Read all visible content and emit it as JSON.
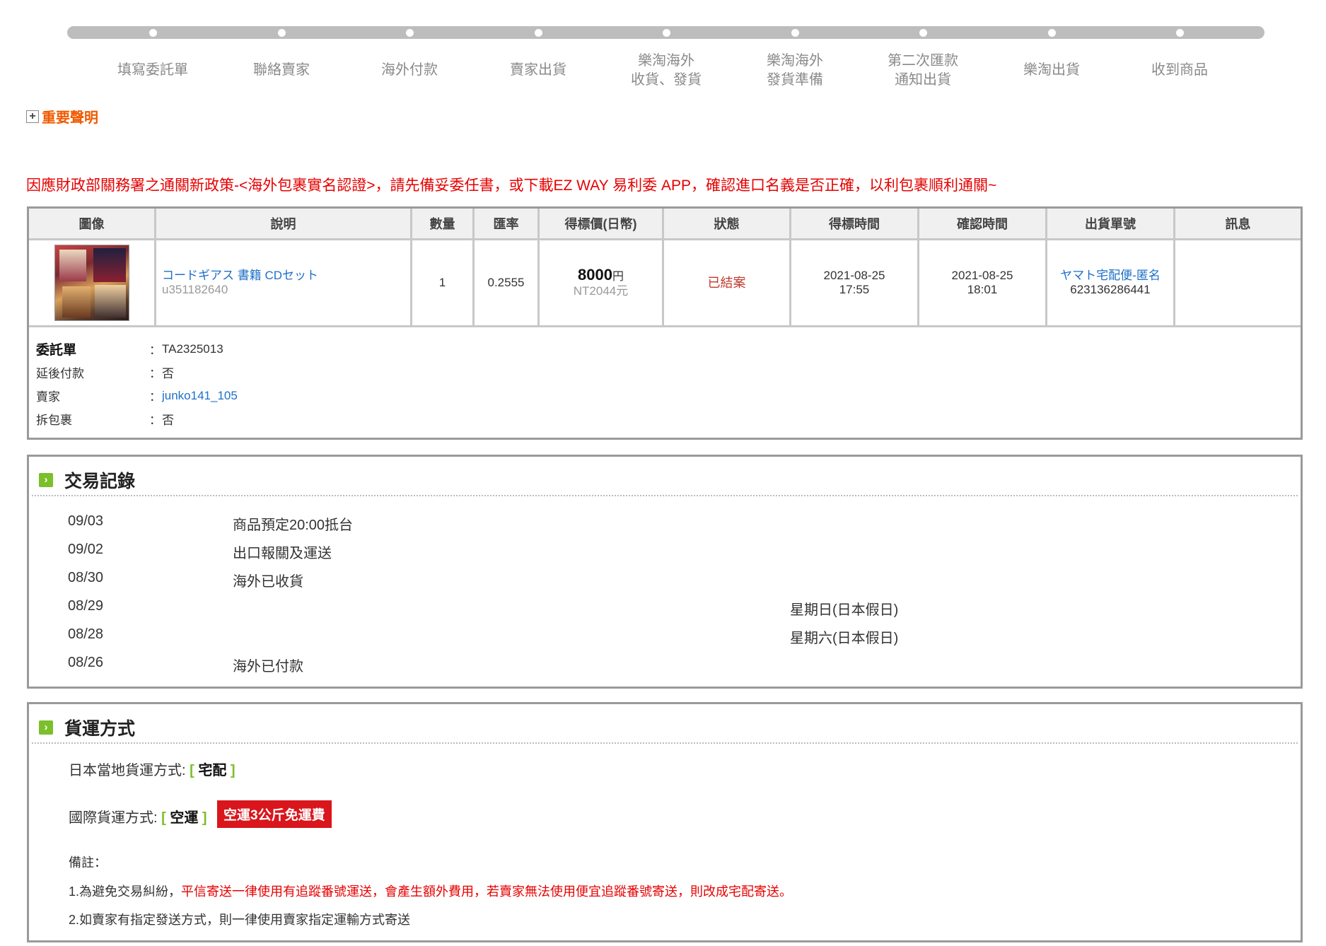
{
  "steps": [
    {
      "line1": "填寫委託單",
      "line2": ""
    },
    {
      "line1": "聯絡賣家",
      "line2": ""
    },
    {
      "line1": "海外付款",
      "line2": ""
    },
    {
      "line1": "賣家出貨",
      "line2": ""
    },
    {
      "line1": "樂淘海外",
      "line2": "收貨、發貨"
    },
    {
      "line1": "樂淘海外",
      "line2": "發貨準備"
    },
    {
      "line1": "第二次匯款",
      "line2": "通知出貨"
    },
    {
      "line1": "樂淘出貨",
      "line2": ""
    },
    {
      "line1": "收到商品",
      "line2": ""
    }
  ],
  "notice": {
    "plus": "+",
    "label": "重要聲明"
  },
  "policy_text": "因應財政部關務署之通關新政策-<海外包裹實名認證>，請先備妥委任書，或下載EZ WAY 易利委 APP，確認進口名義是否正確，以利包裹順利通關~",
  "table": {
    "headers": [
      "圖像",
      "說明",
      "數量",
      "匯率",
      "得標價(日幣)",
      "狀態",
      "得標時間",
      "確認時間",
      "出貨單號",
      "訊息"
    ],
    "row": {
      "title": "コードギアス 書籍 CDセット",
      "item_id": "u351182640",
      "qty": "1",
      "rate": "0.2555",
      "price": "8000",
      "price_unit": "円",
      "price_nt": "NT2044元",
      "status": "已結案",
      "won_date": "2021-08-25",
      "won_time": "17:55",
      "confirm_date": "2021-08-25",
      "confirm_time": "18:01",
      "carrier": "ヤマト宅配便-匿名",
      "tracking": "623136286441",
      "message": ""
    }
  },
  "meta": [
    {
      "key": "委託單",
      "value": "TA2325013"
    },
    {
      "key": "延後付款",
      "value": "否"
    },
    {
      "key": "賣家",
      "value": "junko141_105"
    },
    {
      "key": "拆包裹",
      "value": "否"
    }
  ],
  "meta_colon": "：",
  "trade_log": {
    "title": "交易記錄",
    "rows": [
      {
        "date": "09/03",
        "event": "商品預定20:00抵台",
        "note": ""
      },
      {
        "date": "09/02",
        "event": "出口報關及運送",
        "note": ""
      },
      {
        "date": "08/30",
        "event": "海外已收貨",
        "note": ""
      },
      {
        "date": "08/29",
        "event": "",
        "note": "星期日(日本假日)"
      },
      {
        "date": "08/28",
        "event": "",
        "note": "星期六(日本假日)"
      },
      {
        "date": "08/26",
        "event": "海外已付款",
        "note": ""
      }
    ]
  },
  "shipping": {
    "title": "貨運方式",
    "domestic_label": "日本當地貨運方式:",
    "domestic_value": "宅配",
    "intl_label": "國際貨運方式:",
    "intl_value": "空運",
    "badge": "空運3公斤免運費",
    "bracket_open": "[",
    "bracket_close": "]",
    "remark_label": "備註：",
    "note1_prefix": "1.為避免交易糾紛，",
    "note1_red": "平信寄送一律使用有追蹤番號運送，會產生額外費用，若賣家無法使用便宜追蹤番號寄送，則改成宅配寄送。",
    "note2": "2.如賣家有指定發送方式，則一律使用賣家指定運輸方式寄送"
  },
  "colors": {
    "accent_green": "#7bbf2a",
    "alert_red": "#e60000",
    "notice_orange": "#f05a00",
    "link_blue": "#1e6fc8"
  },
  "icons": {
    "notice_toggle": "plus-box-icon",
    "section": "chevron-right-icon"
  }
}
